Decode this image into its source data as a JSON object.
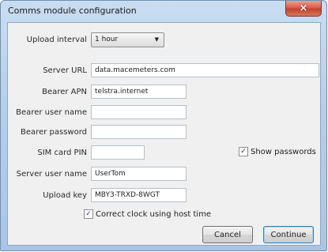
{
  "window": {
    "title": "Comms module configuration",
    "close_glyph": "×"
  },
  "form": {
    "upload_interval": {
      "label": "Upload interval",
      "value": "1 hour"
    },
    "server_url": {
      "label": "Server URL",
      "value": "data.macemeters.com"
    },
    "bearer_apn": {
      "label": "Bearer APN",
      "value": "telstra.internet"
    },
    "bearer_user_name": {
      "label": "Bearer user name",
      "value": ""
    },
    "bearer_password": {
      "label": "Bearer password",
      "value": ""
    },
    "sim_card_pin": {
      "label": "SIM card PIN",
      "value": ""
    },
    "show_passwords": {
      "label": "Show passwords",
      "checked": true,
      "glyph": "✓"
    },
    "server_user_name": {
      "label": "Server user name",
      "value": "UserTom"
    },
    "upload_key": {
      "label": "Upload key",
      "value": "MBY3-TRXD-8WGT"
    },
    "correct_clock": {
      "label": "Correct clock using host time",
      "checked": true,
      "glyph": "✓"
    }
  },
  "buttons": {
    "cancel": "Cancel",
    "continue": "Continue"
  }
}
